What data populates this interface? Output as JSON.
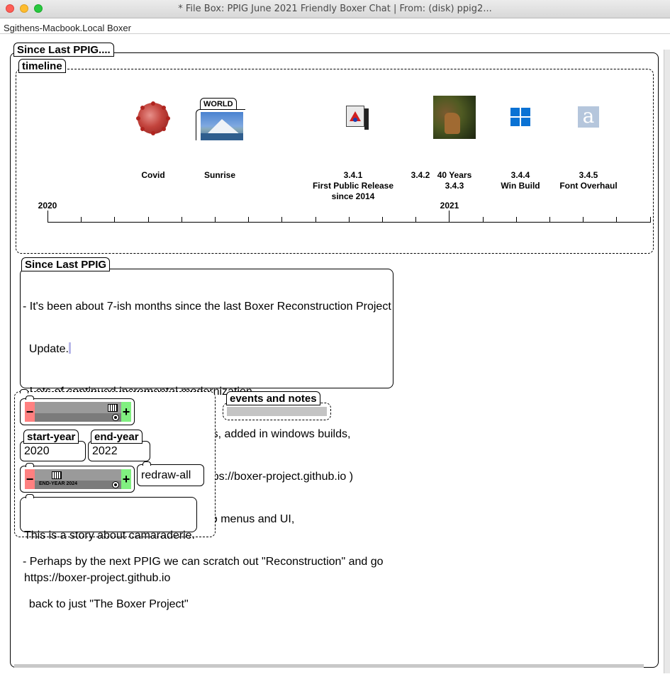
{
  "window": {
    "title": "* File Box: PPIG June 2021 Friendly Boxer Chat | From: (disk) ppig2...",
    "menubar_label": "Sgithens-Macbook.Local Boxer"
  },
  "outer_box": {
    "name": "Since Last PPIG...."
  },
  "timeline": {
    "name": "timeline",
    "world_label": "WORLD",
    "events": [
      {
        "label": "Covid",
        "icon": "covid-virus-icon"
      },
      {
        "label": "Sunrise",
        "icon": "world-mountain-image"
      },
      {
        "label_lines": [
          "3.4.1",
          "First Public Release",
          "since 2014"
        ],
        "icon": "boxer-app-icon"
      },
      {
        "label": "3.4.2"
      },
      {
        "label_lines": [
          "40 Years",
          "3.4.3"
        ],
        "icon": "dog-photo"
      },
      {
        "label_lines": [
          "3.4.4",
          "Win Build"
        ],
        "icon": "windows-logo-icon"
      },
      {
        "label_lines": [
          "3.4.5",
          "Font Overhaul"
        ],
        "icon": "font-a-icon"
      }
    ],
    "axis": {
      "start_label": "2020",
      "mid_label": "2021"
    }
  },
  "notes": {
    "name": "Since Last PPIG",
    "lines": [
      "- It's been about 7-ish months since the last Boxer Reconstruction Project",
      "  Update.",
      "- Lots of continued incremental modernization.",
      "  Fonts, two finger scrolling, crash fixes, added in windows builds,",
      "  obligatory github.io project page ( https://boxer-project.github.io )",
      "- Starting incremental improvements to menus and UI,",
      "- Perhaps by the next PPIG we can scratch out \"Reconstruction\" and go",
      "  back to just \"The Boxer Project\""
    ]
  },
  "controls": {
    "start_year_label": "start-year",
    "start_year_value": "2020",
    "end_year_label": "end-year",
    "end_year_value": "2022",
    "slider2_text": "END-YEAR 2024",
    "redraw_label": "redraw-all",
    "story_lines": [
      "This is a story about camaraderie.",
      "https://boxer-project.github.io"
    ],
    "minus": "−",
    "plus": "+"
  },
  "events_notes": {
    "name": "events and notes"
  },
  "colors": {
    "minus": "#ff8080",
    "plus": "#80f080",
    "slider_track": "#9a9a9a"
  }
}
